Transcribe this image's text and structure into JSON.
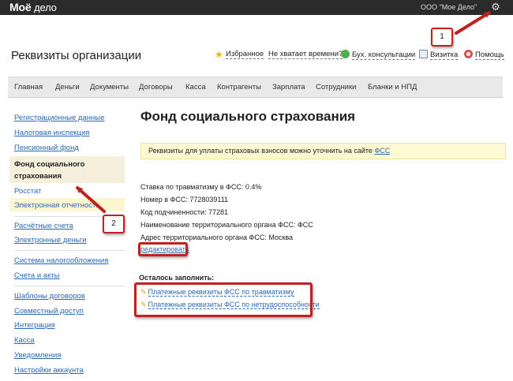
{
  "topbar": {
    "logo": "Моё",
    "logo_tail": "дело",
    "org_name": "ООО \"Мое Дело\"",
    "settings_icon": "gear-icon"
  },
  "page_title": "Реквизиты организации",
  "toolbar": {
    "favorites": "Избранное",
    "no_time": "Не хватает времени?",
    "accounting_consult": "Бух. консультации",
    "business_card": "Визитка",
    "help": "Помощь"
  },
  "nav": [
    "Главная",
    "Деньги",
    "Документы",
    "Договоры",
    "Касса",
    "Контрагенты",
    "Зарплата",
    "Сотрудники",
    "Бланки и НПД"
  ],
  "sidebar": {
    "group1": [
      "Регистрационные данные",
      "Налоговая инспекция",
      "Пенсионный фонд"
    ],
    "active": [
      "Фонд социального",
      "страхования"
    ],
    "group2": [
      "Росстат",
      "Электронная отчетность"
    ],
    "group3": [
      "Расчётные счета",
      "Электронные деньги"
    ],
    "group4": [
      "Система налогообложения",
      "Счета и акты"
    ],
    "group5": [
      "Шаблоны договоров",
      "Совместный доступ",
      "Интеграция",
      "Касса",
      "Уведомления",
      "Настройки аккаунта"
    ]
  },
  "main": {
    "title": "Фонд социального страхования",
    "notice_text": "Реквизиты для уплаты страховых взносов можно уточнить на сайте",
    "notice_link": "ФСС",
    "fields": [
      "Ставка по травматизму в ФСС: 0.4%",
      "Номер в ФСС: 7728039111",
      "Код подчиненности: 77281",
      "Наименование территориального органа ФСС: ФСС",
      "Адрес территориального органа ФСС: Москва"
    ],
    "edit_link": "редактировать",
    "remaining_label": "Осталось заполнить:",
    "requisites": [
      "Платежные реквизиты ФСС по травматизму",
      "Платежные реквизиты ФСС по нетрудоспособности"
    ]
  },
  "annotations": {
    "marker1": "1",
    "marker2": "2",
    "color": "#c0201e"
  }
}
